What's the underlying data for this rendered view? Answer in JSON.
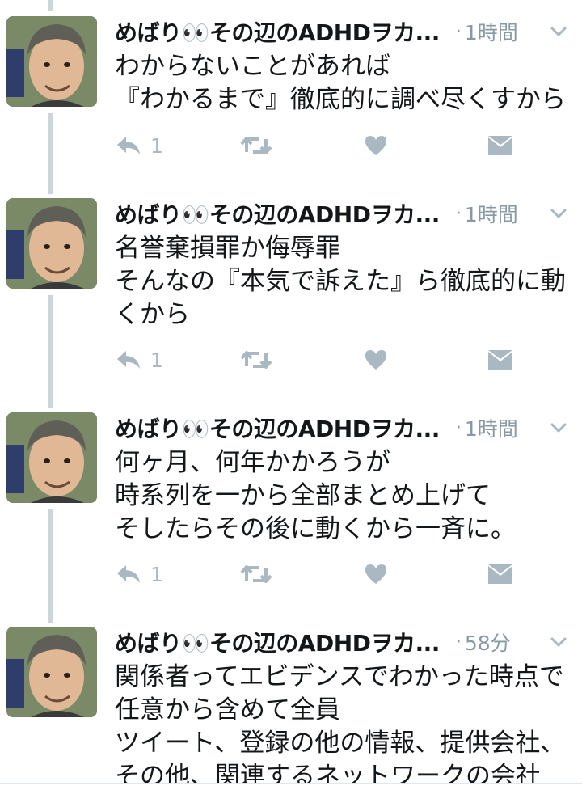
{
  "tweets": [
    {
      "name": "めばり👀その辺のADHDヲカ...",
      "dot": "·",
      "time": "1時間",
      "text": "わからないことがあれば\n『わかるまで』徹底的に調べ尽くすから",
      "reply_count": "1"
    },
    {
      "name": "めばり👀その辺のADHDヲカ...",
      "dot": "·",
      "time": "1時間",
      "text": "名誉棄損罪か侮辱罪\nそんなの『本気で訴えた』ら徹底的に動くから",
      "reply_count": "1"
    },
    {
      "name": "めばり👀その辺のADHDヲカ...",
      "dot": "·",
      "time": "1時間",
      "text": "何ヶ月、何年かかろうが\n時系列を一から全部まとめ上げて\nそしたらその後に動くから一斉に。",
      "reply_count": "1"
    },
    {
      "name": "めばり👀その辺のADHDヲカ...",
      "dot": "·",
      "time": "58分",
      "text": "関係者ってエビデンスでわかった時点で\n任意から含めて全員\nツイート、登録の他の情報、提供会社、\nその他、関連するネットワークの会社",
      "reply_count": ""
    }
  ],
  "icons": {
    "avatar": "avatar-photo",
    "chevron": "chevron-down-icon",
    "reply": "reply-icon",
    "retweet": "retweet-icon",
    "like": "heart-icon",
    "dm": "envelope-icon"
  },
  "colors": {
    "text": "#14171a",
    "muted": "#8899a6",
    "action": "#aab8c2",
    "thread_line": "#ccd6dd"
  }
}
